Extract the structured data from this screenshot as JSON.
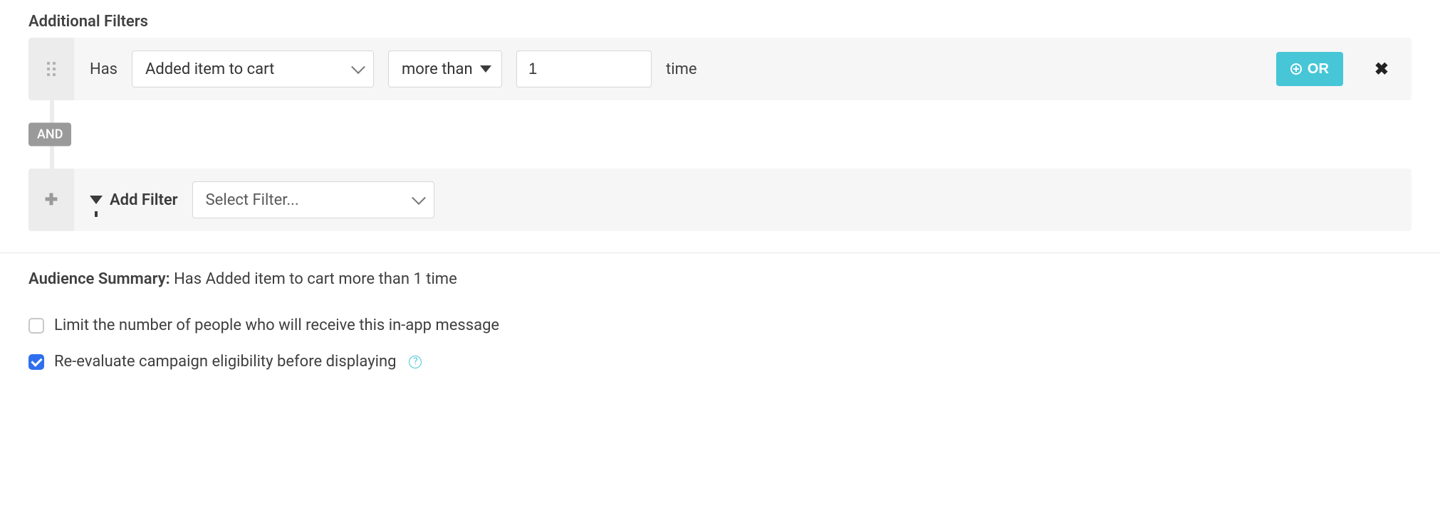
{
  "section_title": "Additional Filters",
  "filter_row": {
    "prefix": "Has",
    "event_select": "Added item to cart",
    "comparator_select": "more than",
    "count_value": "1",
    "suffix": "time",
    "or_button": "OR"
  },
  "connector": {
    "and_label": "AND"
  },
  "add_filter_row": {
    "label": "Add Filter",
    "select_placeholder": "Select Filter..."
  },
  "summary": {
    "label": "Audience Summary:",
    "text": "Has Added item to cart more than 1 time"
  },
  "checkboxes": {
    "limit": {
      "checked": false,
      "label": "Limit the number of people who will receive this in-app message"
    },
    "reevaluate": {
      "checked": true,
      "label": "Re-evaluate campaign eligibility before displaying"
    }
  }
}
